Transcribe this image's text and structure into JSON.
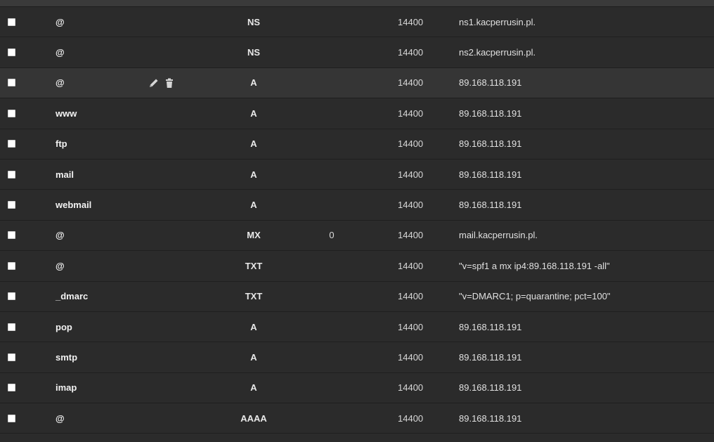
{
  "dns_records": [
    {
      "name": "@",
      "type": "NS",
      "priority": "",
      "ttl": "14400",
      "value": "ns1.kacperrusin.pl."
    },
    {
      "name": "@",
      "type": "NS",
      "priority": "",
      "ttl": "14400",
      "value": "ns2.kacperrusin.pl."
    },
    {
      "name": "@",
      "type": "A",
      "priority": "",
      "ttl": "14400",
      "value": "89.168.118.191",
      "hover": true
    },
    {
      "name": "www",
      "type": "A",
      "priority": "",
      "ttl": "14400",
      "value": "89.168.118.191"
    },
    {
      "name": "ftp",
      "type": "A",
      "priority": "",
      "ttl": "14400",
      "value": "89.168.118.191"
    },
    {
      "name": "mail",
      "type": "A",
      "priority": "",
      "ttl": "14400",
      "value": "89.168.118.191"
    },
    {
      "name": "webmail",
      "type": "A",
      "priority": "",
      "ttl": "14400",
      "value": "89.168.118.191"
    },
    {
      "name": "@",
      "type": "MX",
      "priority": "0",
      "ttl": "14400",
      "value": "mail.kacperrusin.pl."
    },
    {
      "name": "@",
      "type": "TXT",
      "priority": "",
      "ttl": "14400",
      "value": "\"v=spf1 a mx ip4:89.168.118.191 -all\""
    },
    {
      "name": "_dmarc",
      "type": "TXT",
      "priority": "",
      "ttl": "14400",
      "value": "\"v=DMARC1; p=quarantine; pct=100\""
    },
    {
      "name": "pop",
      "type": "A",
      "priority": "",
      "ttl": "14400",
      "value": "89.168.118.191"
    },
    {
      "name": "smtp",
      "type": "A",
      "priority": "",
      "ttl": "14400",
      "value": "89.168.118.191"
    },
    {
      "name": "imap",
      "type": "A",
      "priority": "",
      "ttl": "14400",
      "value": "89.168.118.191"
    },
    {
      "name": "@",
      "type": "AAAA",
      "priority": "",
      "ttl": "14400",
      "value": "89.168.118.191"
    }
  ],
  "icons": {
    "edit": "pencil-icon",
    "delete": "trash-icon"
  },
  "colors": {
    "background": "#2b2b2b",
    "row_hover": "#353535",
    "text": "#e6e6e6"
  }
}
